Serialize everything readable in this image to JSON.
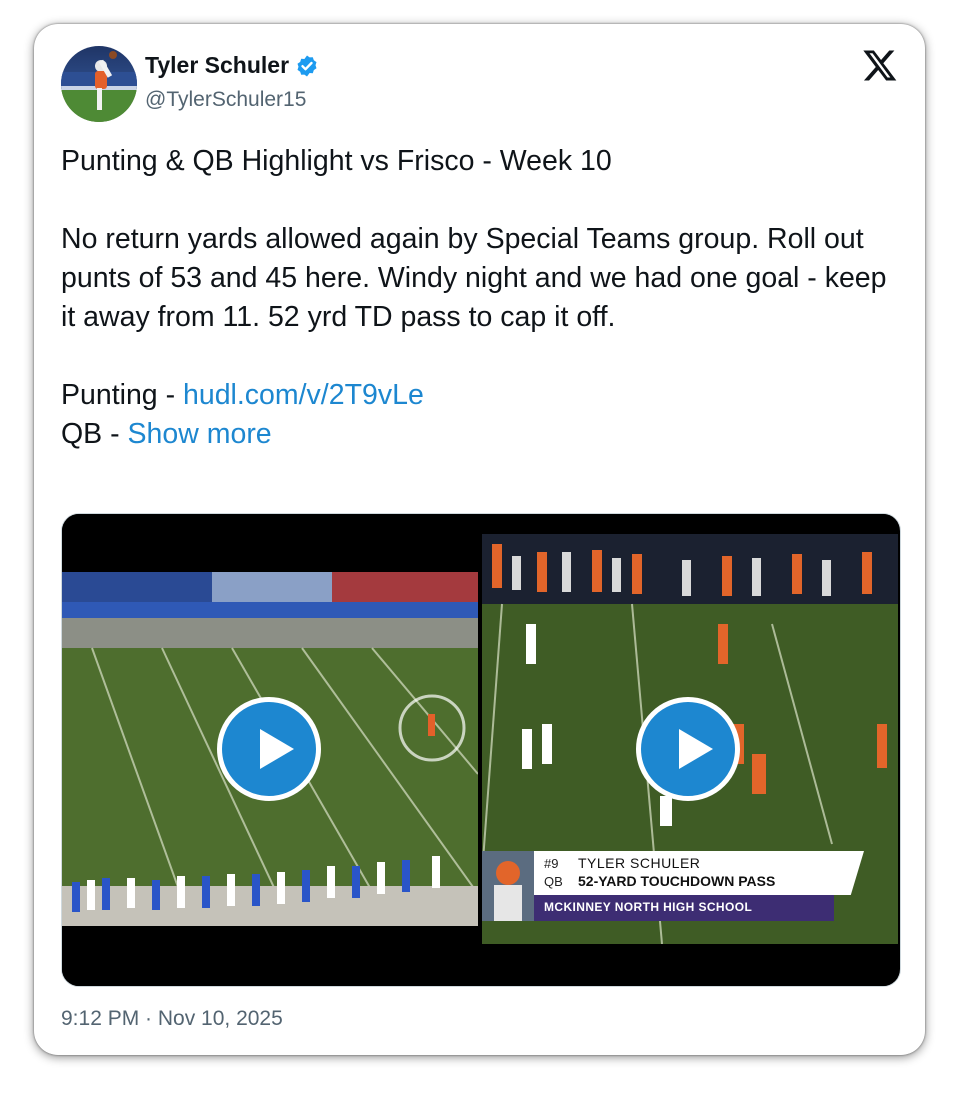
{
  "author": {
    "name": "Tyler Schuler",
    "handle": "@TylerSchuler15",
    "verified": true
  },
  "platform_icon": "x-logo",
  "tweet": {
    "line1": "Punting & QB Highlight vs Frisco - Week 10",
    "paragraph": "No return yards allowed again by Special Teams group. Roll out punts of 53 and 45 here.  Windy night and we had one goal - keep it away from 11.  52 yrd TD pass to cap it off.",
    "punting_label": "Punting - ",
    "punting_link": "hudl.com/v/2T9vLe",
    "qb_label": "QB - ",
    "show_more": "Show more"
  },
  "media": {
    "videos": [
      {
        "icon": "play-icon"
      },
      {
        "icon": "play-icon",
        "lower_third": {
          "number": "#9",
          "player": "TYLER SCHULER",
          "position": "QB",
          "description": "52-YARD TOUCHDOWN PASS",
          "school": "MCKINNEY NORTH HIGH SCHOOL"
        }
      }
    ]
  },
  "timestamp": "9:12 PM · Nov 10, 2025",
  "colors": {
    "link": "#1d87d0",
    "verified": "#1d9bf0",
    "text": "#0f1419",
    "muted": "#536471"
  }
}
